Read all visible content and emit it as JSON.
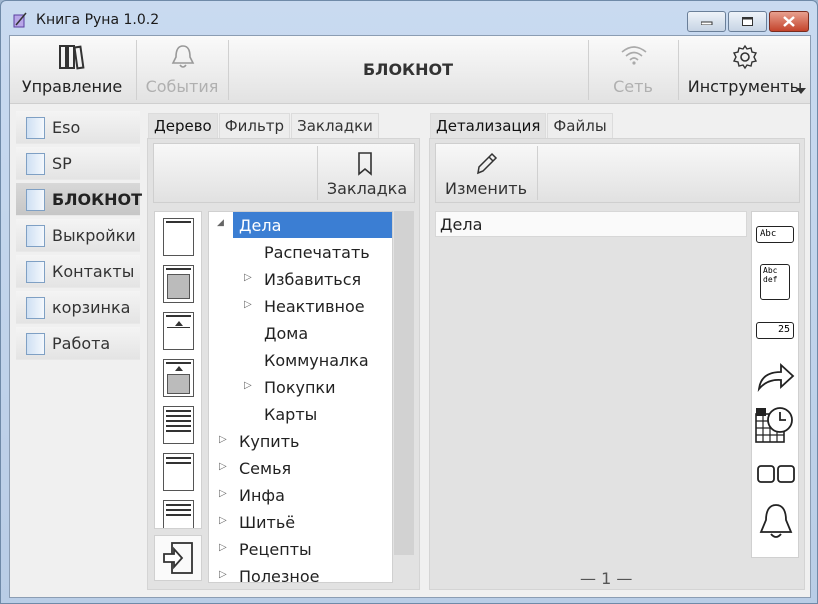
{
  "window": {
    "title": "Книга Руна 1.0.2"
  },
  "toolbar": {
    "manage_label": "Управление",
    "events_label": "События",
    "page_title": "БЛОКНОТ",
    "network_label": "Сеть",
    "tools_label": "Инструменты"
  },
  "nav": {
    "items": [
      {
        "label": "Eso"
      },
      {
        "label": "SP"
      },
      {
        "label": "БЛОКНОТ"
      },
      {
        "label": "Выкройки"
      },
      {
        "label": "Контакты"
      },
      {
        "label": "корзинка"
      },
      {
        "label": "Работа"
      }
    ],
    "active_index": 2
  },
  "left_tabs": [
    "Дерево",
    "Фильтр",
    "Закладки"
  ],
  "bookmark_label": "Закладка",
  "tree": [
    {
      "label": "Дела",
      "level": 0,
      "expanded": true,
      "selected": true
    },
    {
      "label": "Распечатать",
      "level": 1
    },
    {
      "label": "Избавиться",
      "level": 1,
      "collapsed": true
    },
    {
      "label": "Неактивное",
      "level": 1,
      "collapsed": true
    },
    {
      "label": "Дома",
      "level": 1
    },
    {
      "label": "Коммуналка",
      "level": 1
    },
    {
      "label": "Покупки",
      "level": 1,
      "collapsed": true
    },
    {
      "label": "Карты",
      "level": 1
    },
    {
      "label": "Купить",
      "level": 0,
      "collapsed": true
    },
    {
      "label": "Семья",
      "level": 0,
      "collapsed": true
    },
    {
      "label": "Инфа",
      "level": 0,
      "collapsed": true
    },
    {
      "label": "Шитьё",
      "level": 0,
      "collapsed": true
    },
    {
      "label": "Рецепты",
      "level": 0,
      "collapsed": true
    },
    {
      "label": "Полезное",
      "level": 0,
      "collapsed": true
    }
  ],
  "right_tabs": [
    "Детализация",
    "Файлы"
  ],
  "edit_label": "Изменить",
  "detail": {
    "title_value": "Дела",
    "pager": "— 1 —"
  },
  "field_icons": {
    "text_line": "Abc",
    "text_multi": "Abc def",
    "number": "25"
  },
  "colors": {
    "selection": "#3b7ed3",
    "close_button": "#c4442c"
  }
}
